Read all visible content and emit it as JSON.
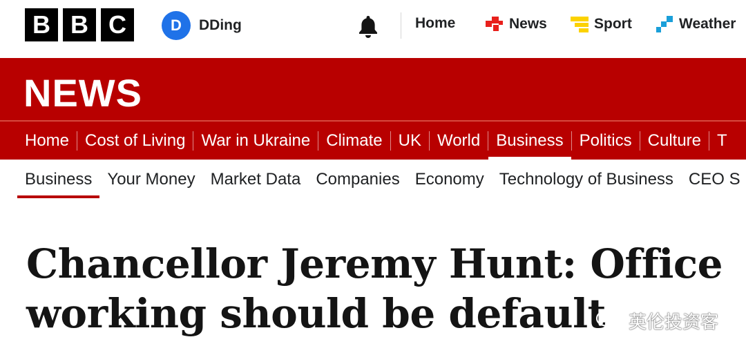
{
  "brand": {
    "logo_letters": [
      "B",
      "B",
      "C"
    ]
  },
  "account": {
    "initial": "D",
    "name": "DDing"
  },
  "top_nav": [
    {
      "label": "Home",
      "icon": null
    },
    {
      "label": "News",
      "icon": "news-squares-icon"
    },
    {
      "label": "Sport",
      "icon": "sport-icon"
    },
    {
      "label": "Weather",
      "icon": "weather-icon"
    }
  ],
  "news_band": {
    "wordmark": "NEWS"
  },
  "section_nav": {
    "items": [
      "Home",
      "Cost of Living",
      "War in Ukraine",
      "Climate",
      "UK",
      "World",
      "Business",
      "Politics",
      "Culture",
      "T"
    ],
    "active": "Business"
  },
  "sub_nav": {
    "items": [
      "Business",
      "Your Money",
      "Market Data",
      "Companies",
      "Economy",
      "Technology of Business",
      "CEO S"
    ],
    "active": "Business"
  },
  "article": {
    "headline_line1": "Chancellor Jeremy Hunt: Office",
    "headline_line2": "working should be default"
  },
  "watermark": {
    "text": "英伦投资客"
  },
  "colors": {
    "bbc_red": "#b80000",
    "avatar_blue": "#1f72e8",
    "news_icon_red": "#e8201c",
    "sport_yellow": "#fcd200",
    "weather_teal": "#1a9fd9"
  }
}
